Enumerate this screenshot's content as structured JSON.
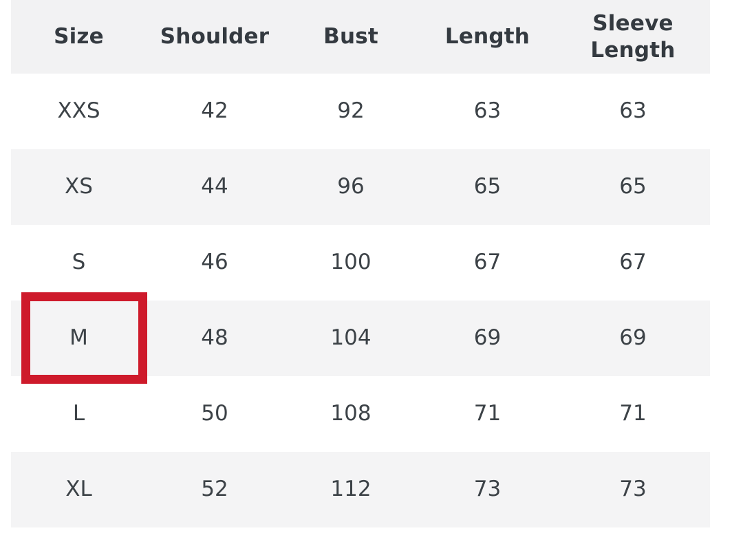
{
  "table": {
    "columns": [
      "Size",
      "Shoulder",
      "Bust",
      "Length",
      "Sleeve Length"
    ],
    "rows": [
      {
        "size": "XXS",
        "shoulder": "42",
        "bust": "92",
        "length": "63",
        "sleeve_length": "63"
      },
      {
        "size": "XS",
        "shoulder": "44",
        "bust": "96",
        "length": "65",
        "sleeve_length": "65"
      },
      {
        "size": "S",
        "shoulder": "46",
        "bust": "100",
        "length": "67",
        "sleeve_length": "67"
      },
      {
        "size": "M",
        "shoulder": "48",
        "bust": "104",
        "length": "69",
        "sleeve_length": "69"
      },
      {
        "size": "L",
        "shoulder": "50",
        "bust": "108",
        "length": "71",
        "sleeve_length": "71"
      },
      {
        "size": "XL",
        "shoulder": "52",
        "bust": "112",
        "length": "73",
        "sleeve_length": "73"
      }
    ]
  },
  "annotation": {
    "highlighted_value": "M",
    "highlight_color": "#ce1a2b"
  },
  "colors": {
    "header_background": "#f2f2f3",
    "stripe_background": "#f4f4f5",
    "row_background": "#ffffff",
    "header_text": "#343a40",
    "cell_text": "#3c4247"
  }
}
